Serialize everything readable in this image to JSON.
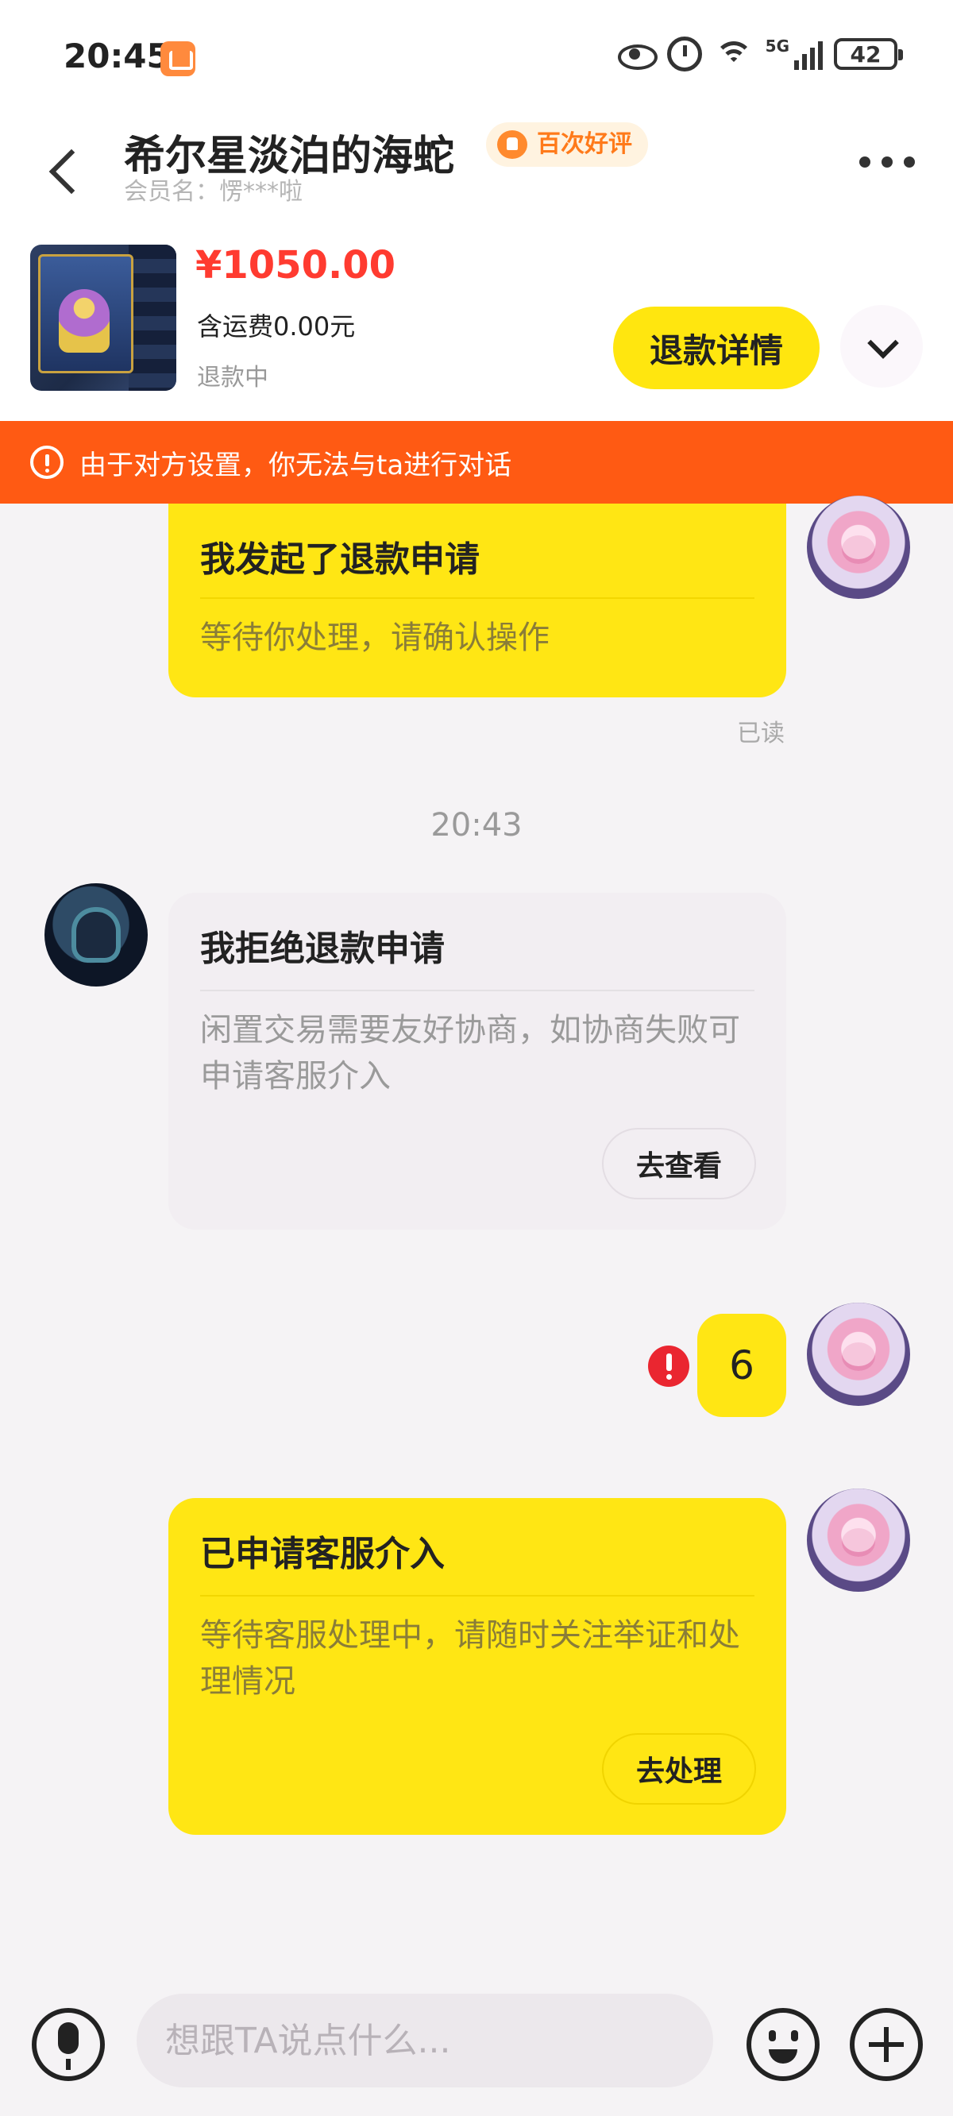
{
  "status_bar": {
    "time": "20:45",
    "battery": "42",
    "network": "5G",
    "icons": [
      "app-badge-icon",
      "eye-icon",
      "alarm-icon",
      "wifi-icon",
      "signal-icon",
      "battery-icon"
    ]
  },
  "header": {
    "title": "希尔星淡泊的海蛇",
    "badge": "百次好评",
    "member_name": "会员名：愣***啦"
  },
  "product": {
    "price": "¥1050.00",
    "shipping": "含运费0.00元",
    "status": "退款中",
    "detail_button": "退款详情"
  },
  "warning": {
    "text": "由于对方设置，你无法与ta进行对话"
  },
  "messages": [
    {
      "sender": "me",
      "title": "我发起了退款申请",
      "body": "等待你处理，请确认操作",
      "read": "已读"
    },
    {
      "time": "20:43"
    },
    {
      "sender": "other",
      "title": "我拒绝退款申请",
      "body": "闲置交易需要友好协商，如协商失败可申请客服介入",
      "button": "去查看"
    },
    {
      "sender": "me",
      "text": "6",
      "status": "send-failed"
    },
    {
      "sender": "me",
      "title": "已申请客服介入",
      "body": "等待客服处理中，请随时关注举证和处理情况",
      "button": "去处理"
    }
  ],
  "input": {
    "placeholder": "想跟TA说点什么..."
  },
  "colors": {
    "accent_yellow": "#ffe614",
    "price_red": "#ff3b30",
    "warning_orange": "#ff5a13",
    "badge_orange": "#ff7a1a",
    "error_red": "#ea2630"
  }
}
